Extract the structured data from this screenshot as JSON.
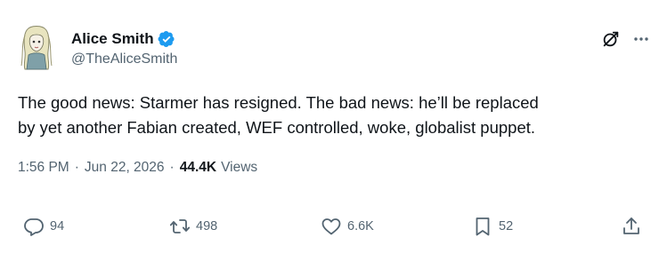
{
  "author": {
    "display_name": "Alice Smith",
    "handle": "@TheAliceSmith",
    "verified_color": "#1d9bf0"
  },
  "tweet": {
    "text_line1": "The good news: Starmer has resigned. The bad news: he’ll be replaced",
    "text_line2": "by yet another Fabian created, WEF controlled, woke, globalist puppet."
  },
  "meta": {
    "time": "1:56 PM",
    "separator": "·",
    "date": "Jun 22, 2026",
    "views_count": "44.4K",
    "views_label": "Views"
  },
  "actions": {
    "replies": "94",
    "reposts": "498",
    "likes": "6.6K",
    "bookmarks": "52"
  },
  "icons": {
    "verified": "verified-badge-icon",
    "grok": "grok-icon",
    "more": "more-icon",
    "reply": "reply-icon",
    "repost": "repost-icon",
    "like": "heart-icon",
    "bookmark": "bookmark-icon",
    "share": "share-icon"
  },
  "colors": {
    "text_primary": "#0f1419",
    "text_secondary": "#536471",
    "accent": "#1d9bf0"
  }
}
